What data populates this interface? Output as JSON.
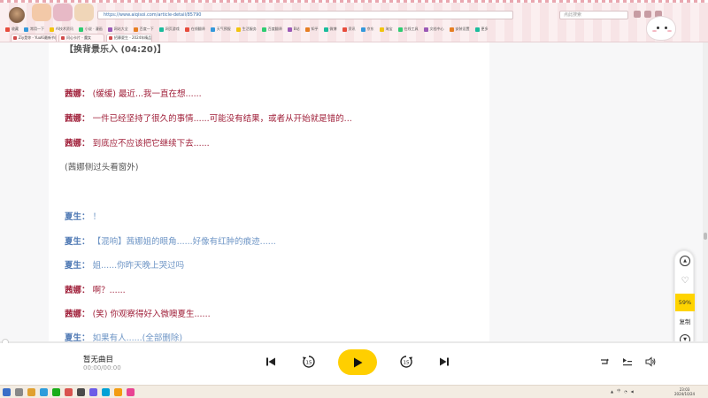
{
  "browser": {
    "url": "https://www.aiqisoi.com/article-detail/85790",
    "search_placeholder": "点此搜索",
    "bookmarks": [
      "收藏",
      "常用一下",
      "AI技术资讯",
      "小说 · 漫画",
      "网站大全",
      "百度一下",
      "网页游戏",
      "在线翻译",
      "天气预报",
      "生活服务",
      "百度翻译",
      "B站",
      "知乎",
      "微博",
      "资讯",
      "京东",
      "淘宝",
      "在线工具",
      "文档中心",
      "安装设置",
      "更多"
    ],
    "tabs": [
      {
        "label": "Ziy是你 - YuuKi最新节目"
      },
      {
        "label": "问心卡片 - 魔女"
      },
      {
        "label": "招募夏生 - 2024年精品"
      }
    ]
  },
  "article": {
    "scene_title": "【换背景乐入 (04:20)】",
    "lines": [
      {
        "speaker": "茜娜",
        "text": "(缓缓) 最近...我一直在想......",
        "role": "xn"
      },
      {
        "speaker": "茜娜",
        "text": "一件已经坚持了很久的事情......可能没有结果，或者从开始就是错的...",
        "role": "xn"
      },
      {
        "speaker": "茜娜",
        "text": "到底应不应该把它继续下去......",
        "role": "xn"
      },
      {
        "speaker": "",
        "text": "(茜娜侧过头看窗外)",
        "role": "gray"
      },
      {
        "speaker": "夏生",
        "text": "！",
        "role": "xs"
      },
      {
        "speaker": "夏生",
        "text": "【混响】茜娜姐的眼角......好像有红肿的痕迹......",
        "role": "xs"
      },
      {
        "speaker": "夏生",
        "text": "姐......你昨天晚上哭过吗",
        "role": "xs"
      },
      {
        "speaker": "茜娜",
        "text": "啊？......",
        "role": "xn"
      },
      {
        "speaker": "茜娜",
        "text": "(笑) 你观察得好入微噢夏生......",
        "role": "xn"
      },
      {
        "speaker": "夏生",
        "text": "如果有人......(全部删除)",
        "role": "xs"
      }
    ]
  },
  "float_widget": {
    "percent": "59%",
    "copy_label": "复制"
  },
  "player": {
    "title": "暂无曲目",
    "time": "00:00/00:00",
    "progress": 0.0
  },
  "taskbar": {
    "time": "23:03",
    "date": "2024/10/24",
    "lang": "中"
  },
  "colors": {
    "accent": "#ffcf00",
    "speaker_xn": "#a0203a",
    "speaker_xs": "#4f79b4"
  }
}
